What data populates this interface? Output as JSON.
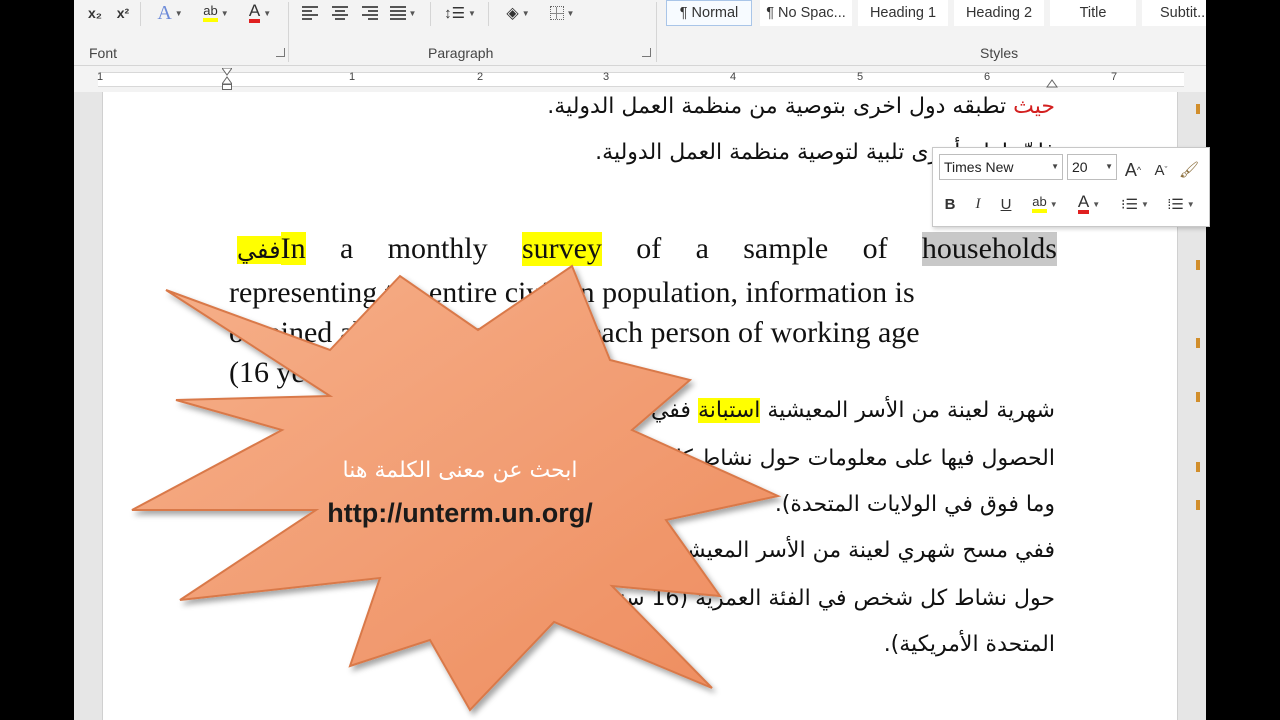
{
  "ribbon": {
    "font_group_label": "Font",
    "paragraph_group_label": "Paragraph",
    "styles_group_label": "Styles",
    "subscript_label": "x₂",
    "superscript_label": "x²",
    "text_effects_label": "A",
    "highlight_label": "ab",
    "font_color_label": "A",
    "styles": [
      {
        "label": "¶ Normal",
        "selected": true
      },
      {
        "label": "¶ No Spac...",
        "selected": false
      },
      {
        "label": "Heading 1",
        "selected": false
      },
      {
        "label": "Heading 2",
        "selected": false
      },
      {
        "label": "Title",
        "selected": false
      },
      {
        "label": "Subtit...",
        "selected": false
      }
    ]
  },
  "ruler": {
    "numbers": [
      "1",
      "1",
      "2",
      "3",
      "4",
      "5",
      "6",
      "7"
    ]
  },
  "document": {
    "ar_line1_red": "حيث",
    "ar_line1_highlight": "تطبقه",
    "ar_line1_rest": "دول اخرى بتوصية من منظمة العمل الدولية.",
    "ar_line2": "فإنّ بلدان أخرى تلبية لتوصية منظمة العمل الدولية.",
    "en_p_line1": {
      "hl_prefix": "ففي",
      "word_in": "In",
      "a": "a",
      "monthly": "monthly",
      "survey": "survey",
      "of1": "of",
      "a2": "a",
      "sample": "sample",
      "of2": "of",
      "households": "households"
    },
    "en_p_line2": "representing the entire civilian population, information is",
    "en_p_line3": "obtained about the activity of each person of working age",
    "en_p_line4": "(16 years or over in the U.S.).",
    "ar_p2_line1_pre": "ففي",
    "ar_p2_line1_hl": "استبانة",
    "ar_p2_line1_rest": "شهرية لعينة من الأسر المعيشية",
    "ar_p2_line2": "الحصول فيها على معلومات حول نشاط كل شخص في سن العمل",
    "ar_p2_line3": "وما فوق في الولايات المتحدة).",
    "ar_p3_line1": "ففي مسح شهري لعينة من الأسر المعيشية الممثلة لجميع السكان",
    "ar_p3_line2": "حول نشاط كل شخص في الفئة العمرية (16 سنة فما فوق في الولايات",
    "ar_p3_line3": "المتحدة الأمريكية)."
  },
  "minibar": {
    "font_name": "Times New Roman",
    "font_size": "20",
    "grow_label": "A",
    "shrink_label": "A",
    "bold_label": "B",
    "italic_label": "I",
    "underline_label": "U",
    "highlight_label": "ab",
    "font_color_label": "A"
  },
  "overlay": {
    "arabic_text": "ابحث عن معنى الكلمة هنا",
    "url": "http://unterm.un.org/",
    "fill_color": "#f0956a"
  }
}
